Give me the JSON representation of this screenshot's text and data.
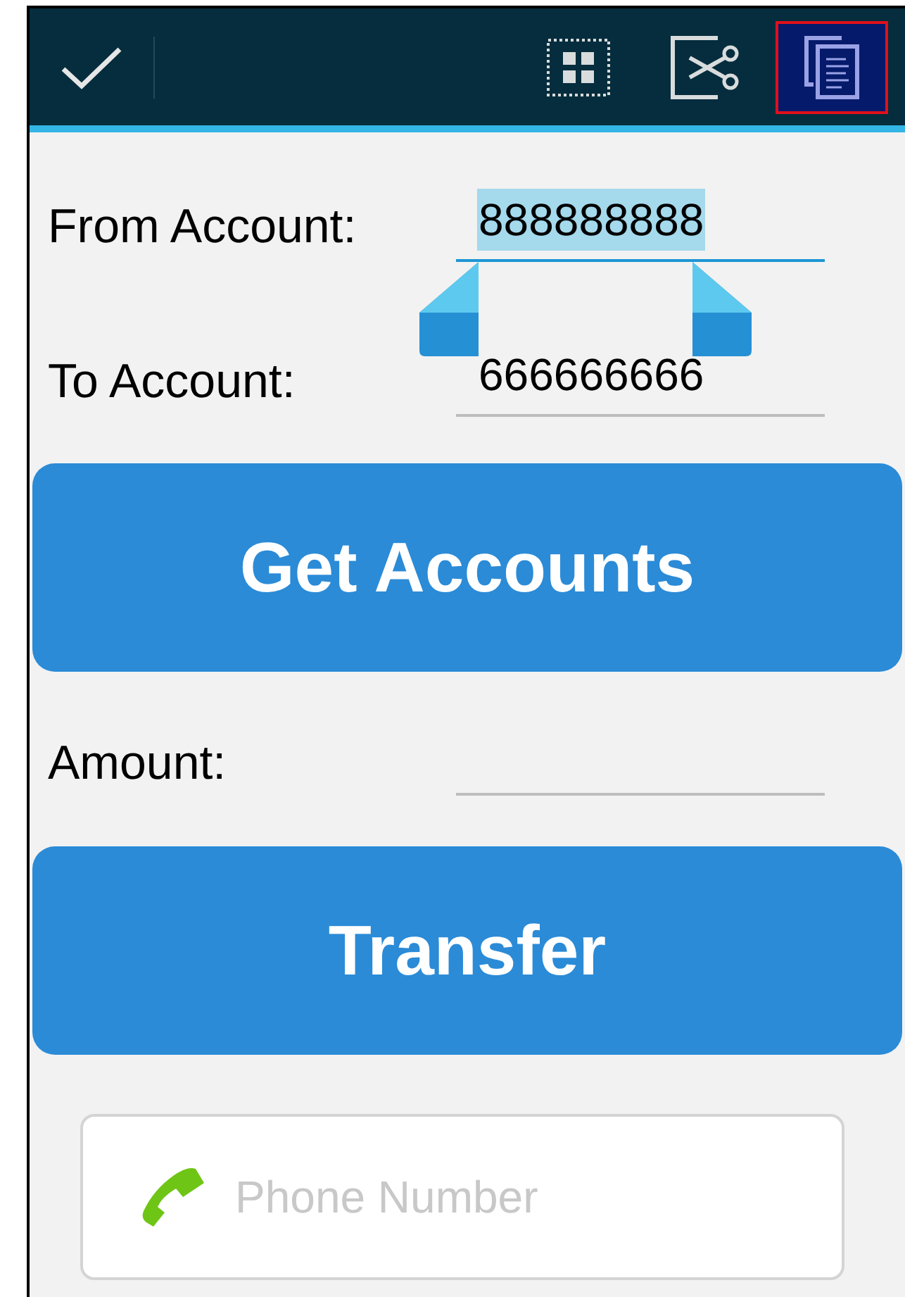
{
  "action_bar": {
    "actions": [
      {
        "kind": "done",
        "selected": false
      },
      {
        "kind": "select_all",
        "selected": false
      },
      {
        "kind": "cut",
        "selected": false
      },
      {
        "kind": "copy",
        "selected": true
      }
    ]
  },
  "form": {
    "fields": [
      {
        "label": "From Account:",
        "value": "888888888",
        "focused": true,
        "text_selected": true
      },
      {
        "label": "To Account:",
        "value": "666666666",
        "focused": false,
        "text_selected": false
      }
    ],
    "get_accounts_button": "Get Accounts",
    "amount": {
      "label": "Amount:",
      "focused": false
    },
    "transfer_button": "Transfer",
    "phone": {
      "placeholder": "Phone Number"
    }
  }
}
